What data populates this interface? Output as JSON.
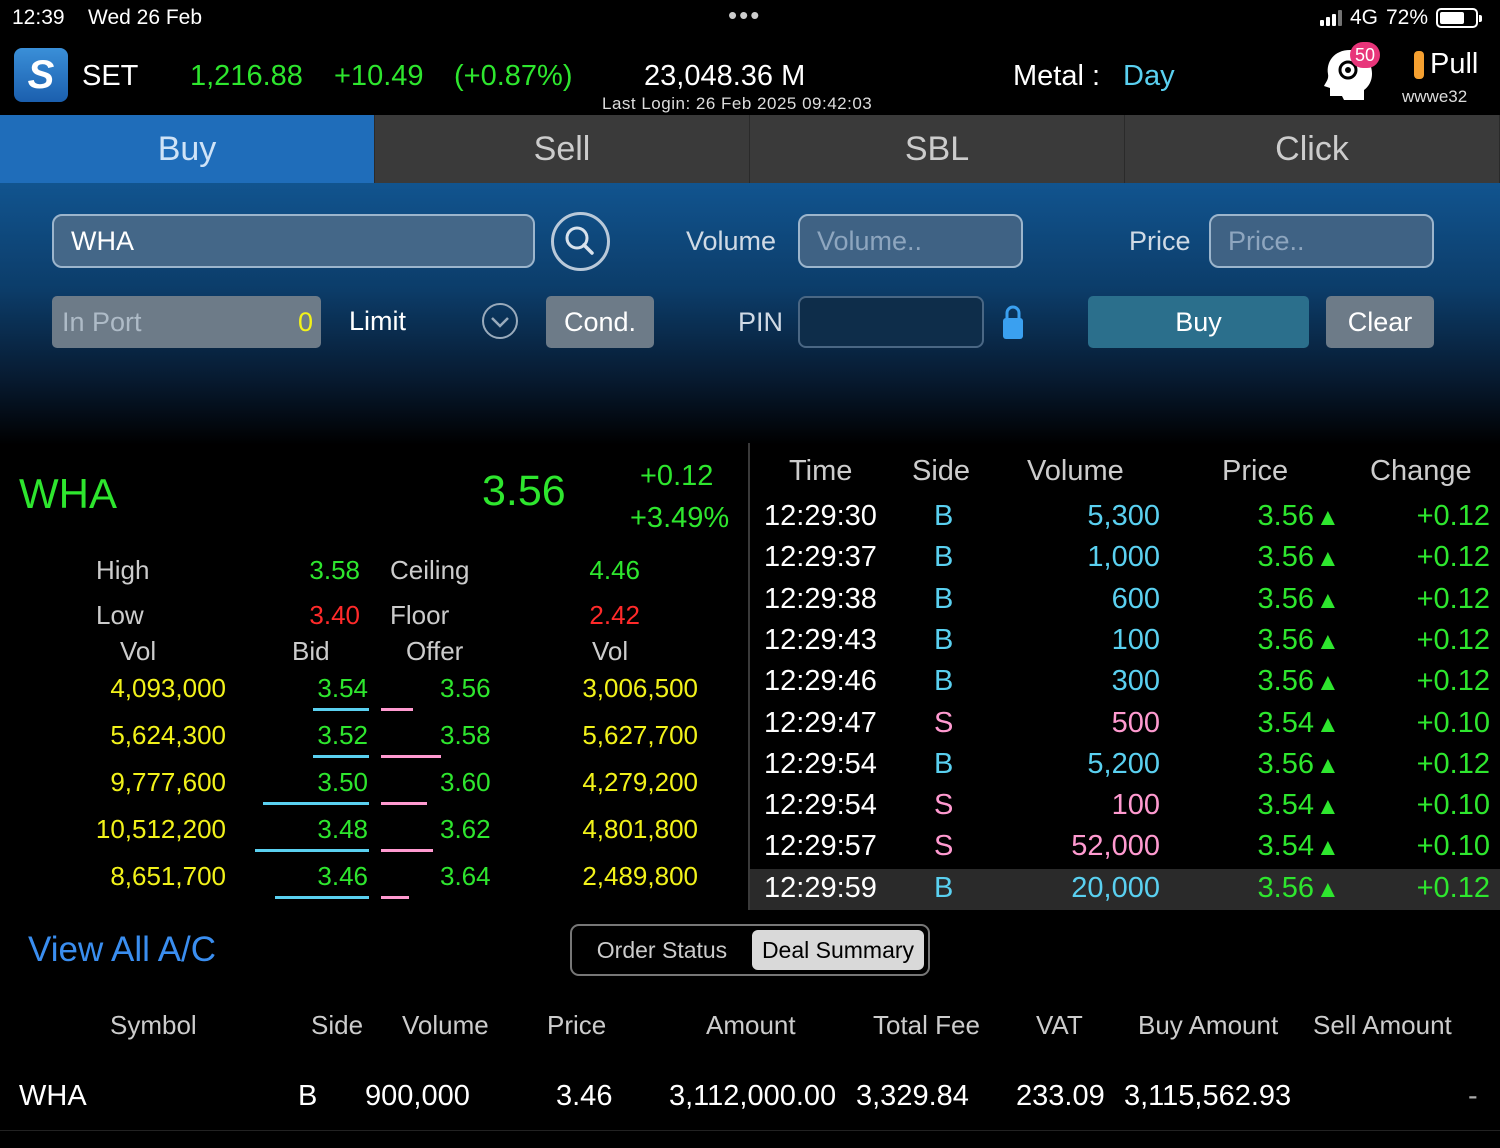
{
  "status_bar": {
    "time": "12:39",
    "date": "Wed 26 Feb",
    "dots": "•••",
    "network": "4G",
    "battery": "72%"
  },
  "header": {
    "logo": "S",
    "market": "SET",
    "index": "1,216.88",
    "change": "+10.49",
    "change_pct": "(+0.87%)",
    "value": "23,048.36 M",
    "last_login": "Last Login: 26 Feb 2025 09:42:03",
    "metal_label": "Metal :",
    "metal_value": "Day",
    "notifications": "50",
    "pull_label": "Pull",
    "username": "wwwe32"
  },
  "tabs": [
    {
      "label": "Buy"
    },
    {
      "label": "Sell"
    },
    {
      "label": "SBL"
    },
    {
      "label": "Click"
    }
  ],
  "order_form": {
    "symbol": "WHA",
    "volume_label": "Volume",
    "volume_placeholder": "Volume..",
    "price_label": "Price",
    "price_placeholder": "Price..",
    "inport_label": "In Port",
    "inport_value": "0",
    "order_type": "Limit",
    "cond_label": "Cond.",
    "pin_label": "PIN",
    "buy_label": "Buy",
    "clear_label": "Clear"
  },
  "stock": {
    "symbol": "WHA",
    "last": "3.56",
    "change": "+0.12",
    "change_pct": "+3.49%",
    "high_label": "High",
    "high": "3.58",
    "low_label": "Low",
    "low": "3.40",
    "ceiling_label": "Ceiling",
    "ceiling": "4.46",
    "floor_label": "Floor",
    "floor": "2.42"
  },
  "bid_offer": {
    "headers": {
      "vol_bid": "Vol",
      "bid": "Bid",
      "offer": "Offer",
      "vol_offer": "Vol"
    },
    "rows": [
      {
        "bid_vol": "4,093,000",
        "bid": "3.54",
        "offer": "3.56",
        "offer_vol": "3,006,500"
      },
      {
        "bid_vol": "5,624,300",
        "bid": "3.52",
        "offer": "3.58",
        "offer_vol": "5,627,700"
      },
      {
        "bid_vol": "9,777,600",
        "bid": "3.50",
        "offer": "3.60",
        "offer_vol": "4,279,200"
      },
      {
        "bid_vol": "10,512,200",
        "bid": "3.48",
        "offer": "3.62",
        "offer_vol": "4,801,800"
      },
      {
        "bid_vol": "8,651,700",
        "bid": "3.46",
        "offer": "3.64",
        "offer_vol": "2,489,800"
      }
    ]
  },
  "ticker": {
    "headers": {
      "time": "Time",
      "side": "Side",
      "volume": "Volume",
      "price": "Price",
      "change": "Change"
    },
    "rows": [
      {
        "time": "12:29:30",
        "side": "B",
        "volume": "5,300",
        "price": "3.56",
        "change": "+0.12"
      },
      {
        "time": "12:29:37",
        "side": "B",
        "volume": "1,000",
        "price": "3.56",
        "change": "+0.12"
      },
      {
        "time": "12:29:38",
        "side": "B",
        "volume": "600",
        "price": "3.56",
        "change": "+0.12"
      },
      {
        "time": "12:29:43",
        "side": "B",
        "volume": "100",
        "price": "3.56",
        "change": "+0.12"
      },
      {
        "time": "12:29:46",
        "side": "B",
        "volume": "300",
        "price": "3.56",
        "change": "+0.12"
      },
      {
        "time": "12:29:47",
        "side": "S",
        "volume": "500",
        "price": "3.54",
        "change": "+0.10"
      },
      {
        "time": "12:29:54",
        "side": "B",
        "volume": "5,200",
        "price": "3.56",
        "change": "+0.12"
      },
      {
        "time": "12:29:54",
        "side": "S",
        "volume": "100",
        "price": "3.54",
        "change": "+0.10"
      },
      {
        "time": "12:29:57",
        "side": "S",
        "volume": "52,000",
        "price": "3.54",
        "change": "+0.10"
      },
      {
        "time": "12:29:59",
        "side": "B",
        "volume": "20,000",
        "price": "3.56",
        "change": "+0.12"
      }
    ]
  },
  "bottom": {
    "view_all": "View All A/C",
    "seg_order_status": "Order Status",
    "seg_deal_summary": "Deal Summary"
  },
  "deal_summary": {
    "headers": {
      "symbol": "Symbol",
      "side": "Side",
      "volume": "Volume",
      "price": "Price",
      "amount": "Amount",
      "total_fee": "Total Fee",
      "vat": "VAT",
      "buy_amount": "Buy Amount",
      "sell_amount": "Sell Amount"
    },
    "row": {
      "symbol": "WHA",
      "side": "B",
      "volume": "900,000",
      "price": "3.46",
      "amount": "3,112,000.00",
      "total_fee": "3,329.84",
      "vat": "233.09",
      "buy_amount": "3,115,562.93",
      "sell_amount": "-"
    }
  }
}
